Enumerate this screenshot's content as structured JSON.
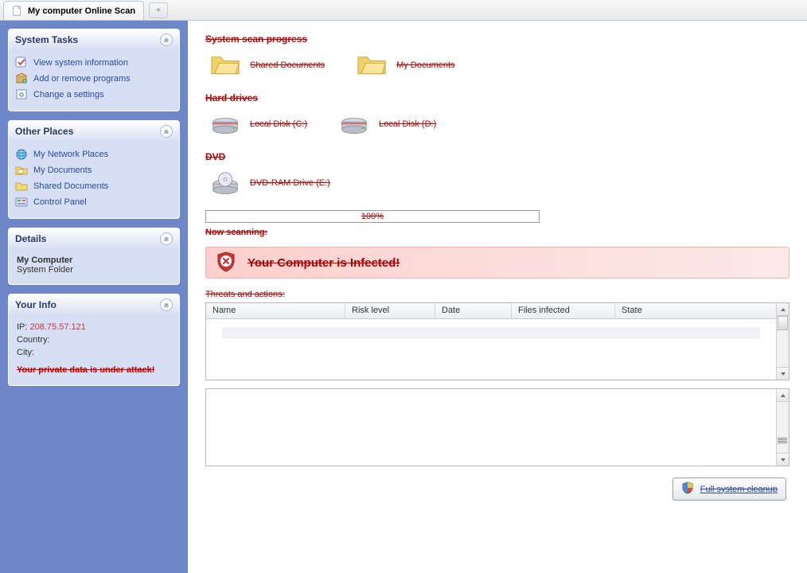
{
  "tabbar": {
    "active_tab": "My computer Online Scan",
    "new_tab_glyph": "+"
  },
  "sidebar": {
    "system_tasks": {
      "title": "System Tasks",
      "items": [
        {
          "icon": "info-check",
          "label": "View system information"
        },
        {
          "icon": "pkg-plus-minus",
          "label": "Add or remove programs"
        },
        {
          "icon": "gear-doc",
          "label": "Change a settings"
        }
      ]
    },
    "other_places": {
      "title": "Other Places",
      "items": [
        {
          "icon": "network-globe",
          "label": "My Network Places"
        },
        {
          "icon": "folder-doc",
          "label": "My Documents"
        },
        {
          "icon": "folder-open",
          "label": "Shared Documents"
        },
        {
          "icon": "control-panel",
          "label": "Control Panel"
        }
      ]
    },
    "details": {
      "title": "Details",
      "name": "My Computer",
      "type": "System Folder"
    },
    "your_info": {
      "title": "Your Info",
      "ip_label": "IP:",
      "ip_value": "208.75.57.121",
      "country_label": "Country:",
      "city_label": "City:",
      "warning": "Your private data is under attack!"
    }
  },
  "main": {
    "section_scan_progress": "System scan progress",
    "scan_items": {
      "shared_documents": "Shared Documents",
      "my_documents": "My Documents"
    },
    "section_hard_drives": "Hard drives",
    "drive_items": {
      "c": "Local Disk (C:)",
      "d": "Local Disk (D:)"
    },
    "section_dvd": "DVD",
    "dvd_item": "DVD-RAM Drive (E:)",
    "progress_pct": "100%",
    "now_scanning": "Now scanning:",
    "alert_text": "Your Computer is Infected!",
    "threats_label": "Threats and actions:",
    "columns": {
      "name": "Name",
      "risk": "Risk level",
      "date": "Date",
      "files": "Files infected",
      "state": "State"
    },
    "cleanup_label": "Full system cleanup"
  }
}
